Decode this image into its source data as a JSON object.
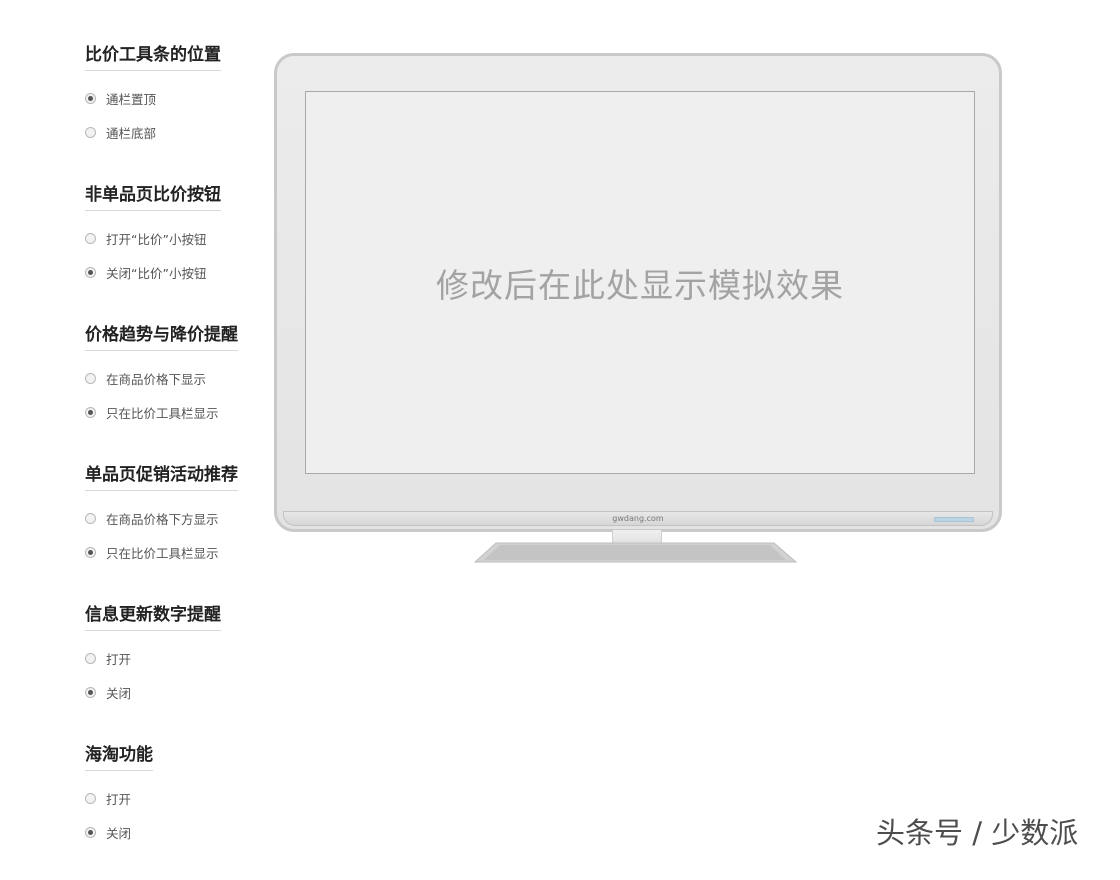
{
  "sections": [
    {
      "title": "比价工具条的位置",
      "options": [
        {
          "label": "通栏置顶",
          "checked": true
        },
        {
          "label": "通栏底部",
          "checked": false
        }
      ]
    },
    {
      "title": "非单品页比价按钮",
      "options": [
        {
          "label": "打开“比价”小按钮",
          "checked": false
        },
        {
          "label": "关闭“比价”小按钮",
          "checked": true
        }
      ]
    },
    {
      "title": "价格趋势与降价提醒",
      "options": [
        {
          "label": "在商品价格下显示",
          "checked": false
        },
        {
          "label": "只在比价工具栏显示",
          "checked": true
        }
      ]
    },
    {
      "title": "单品页促销活动推荐",
      "options": [
        {
          "label": "在商品价格下方显示",
          "checked": false
        },
        {
          "label": "只在比价工具栏显示",
          "checked": true
        }
      ]
    },
    {
      "title": "信息更新数字提醒",
      "options": [
        {
          "label": "打开",
          "checked": false
        },
        {
          "label": "关闭",
          "checked": true
        }
      ]
    },
    {
      "title": "海淘功能",
      "options": [
        {
          "label": "打开",
          "checked": false
        },
        {
          "label": "关闭",
          "checked": true
        }
      ]
    }
  ],
  "preview": {
    "screen_text": "修改后在此处显示模拟效果",
    "brand": "gwdang.com"
  },
  "watermark": "头条号 / 少数派"
}
